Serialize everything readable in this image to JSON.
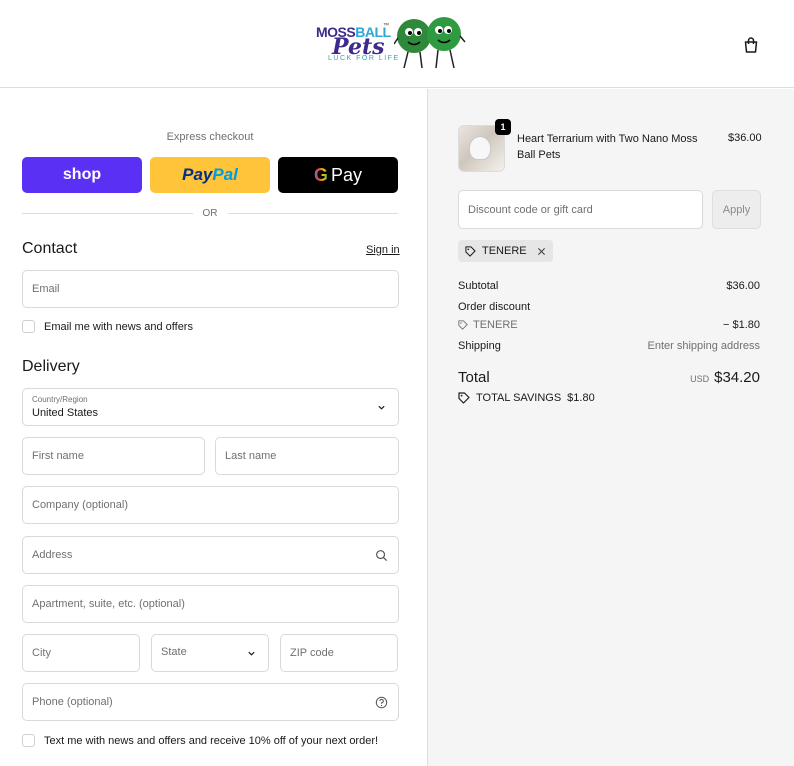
{
  "header": {
    "logo": {
      "word1": "MOSS",
      "word2": "BALL",
      "tm": "™",
      "word3": "Pets",
      "tagline": "LUCK FOR LIFE"
    },
    "bag_icon": "shopping-bag-icon"
  },
  "checkout": {
    "express_label": "Express checkout",
    "shop_label": "shop",
    "paypal_label_1": "Pay",
    "paypal_label_2": "Pal",
    "gpay_g": "G",
    "gpay_label": "Pay",
    "or_label": "OR"
  },
  "contact": {
    "title": "Contact",
    "sign_in": "Sign in",
    "email_placeholder": "Email",
    "news_checkbox_label": "Email me with news and offers"
  },
  "delivery": {
    "title": "Delivery",
    "country_label": "Country/Region",
    "country_value": "United States",
    "first_name_placeholder": "First name",
    "last_name_placeholder": "Last name",
    "company_placeholder": "Company (optional)",
    "address_placeholder": "Address",
    "apartment_placeholder": "Apartment, suite, etc. (optional)",
    "city_placeholder": "City",
    "state_placeholder": "State",
    "zip_placeholder": "ZIP code",
    "phone_placeholder": "Phone (optional)",
    "text_checkbox_label": "Text me with news and offers and receive 10% off of your next order!"
  },
  "order": {
    "item": {
      "quantity": "1",
      "name": "Heart Terrarium with Two Nano Moss Ball Pets",
      "price": "$36.00"
    },
    "discount_placeholder": "Discount code or gift card",
    "apply_label": "Apply",
    "applied_code": "TENERE",
    "subtotal_label": "Subtotal",
    "subtotal_value": "$36.00",
    "order_discount_label": "Order discount",
    "discount_code": "TENERE",
    "discount_value": "− $1.80",
    "shipping_label": "Shipping",
    "shipping_value": "Enter shipping address",
    "total_label": "Total",
    "total_currency": "USD",
    "total_value": "$34.20",
    "savings_label": "TOTAL SAVINGS",
    "savings_value": "$1.80"
  },
  "colors": {
    "shop": "#5a31f4",
    "paypal": "#ffc439",
    "gpay": "#000000",
    "summary_bg": "#f5f5f5"
  }
}
